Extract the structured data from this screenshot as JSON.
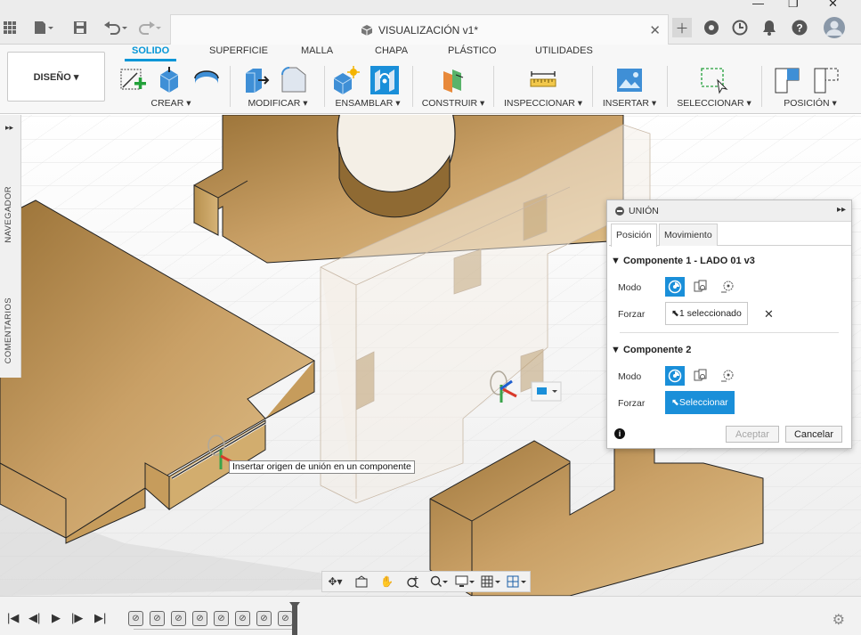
{
  "window": {
    "doc_title": "VISUALIZACIÓN v1*",
    "minimize_icon": "minimize-icon",
    "maximize_icon": "maximize-icon",
    "close_icon": "close-icon"
  },
  "ribbon": {
    "workspace": "DISEÑO ▾",
    "tabs": [
      "SOLIDO",
      "SUPERFICIE",
      "MALLA",
      "CHAPA",
      "PLÁSTICO",
      "UTILIDADES"
    ],
    "active_tab": "SOLIDO",
    "groups": [
      "CREAR ▾",
      "MODIFICAR ▾",
      "ENSAMBLAR ▾",
      "CONSTRUIR ▾",
      "INSPECCIONAR ▾",
      "INSERTAR ▾",
      "SELECCIONAR ▾",
      "POSICIÓN ▾"
    ],
    "accent_color": "#0696d7"
  },
  "side_panel": {
    "navigator": "NAVEGADOR",
    "comments": "COMENTARIOS"
  },
  "union_dialog": {
    "title": "UNIÓN",
    "tabs": [
      "Posición",
      "Movimiento"
    ],
    "active_tab": "Posición",
    "component1": {
      "header": "Componente 1 - LADO 01 v3",
      "mode_label": "Modo",
      "force_label": "Forzar",
      "force_value": "1 seleccionado"
    },
    "component2": {
      "header": "Componente 2",
      "mode_label": "Modo",
      "force_label": "Forzar",
      "force_value": "Seleccionar"
    },
    "accept_label": "Aceptar",
    "cancel_label": "Cancelar",
    "selected_color": "#1a8fd9"
  },
  "viewport": {
    "tooltip": "Insertar origen de unión en un componente",
    "wood_color": "#c29a5e"
  }
}
